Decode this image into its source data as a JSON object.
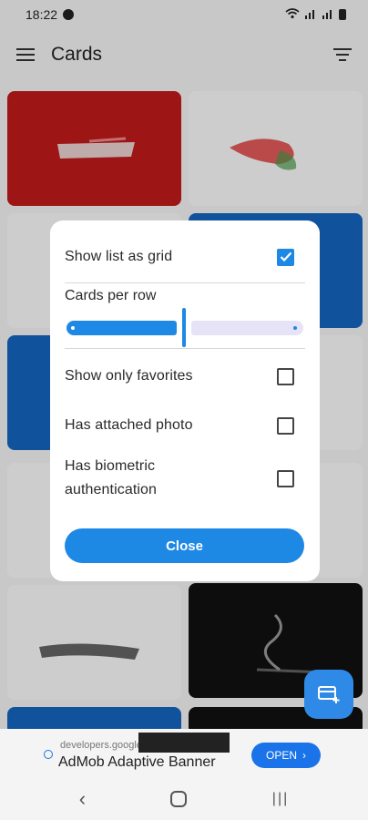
{
  "status_bar": {
    "time": "18:22"
  },
  "app_bar": {
    "title": "Cards"
  },
  "dialog": {
    "show_grid_label": "Show list as grid",
    "show_grid_checked": true,
    "cards_per_row_label": "Cards per row",
    "slider_value_fraction": 0.5,
    "favorites_label": "Show only favorites",
    "favorites_checked": false,
    "photo_label": "Has attached photo",
    "photo_checked": false,
    "biometric_label_line1": "Has biometric",
    "biometric_label_line2": "authentication",
    "biometric_checked": false,
    "close_label": "Close"
  },
  "ad": {
    "url": "developers.google",
    "title": "AdMob Adaptive Banner",
    "open_label": "OPEN"
  },
  "colors": {
    "accent": "#1e88e5",
    "card_red": "#c01a1a",
    "card_blue": "#1565c0",
    "card_black": "#111111",
    "card_white": "#fafafa"
  }
}
